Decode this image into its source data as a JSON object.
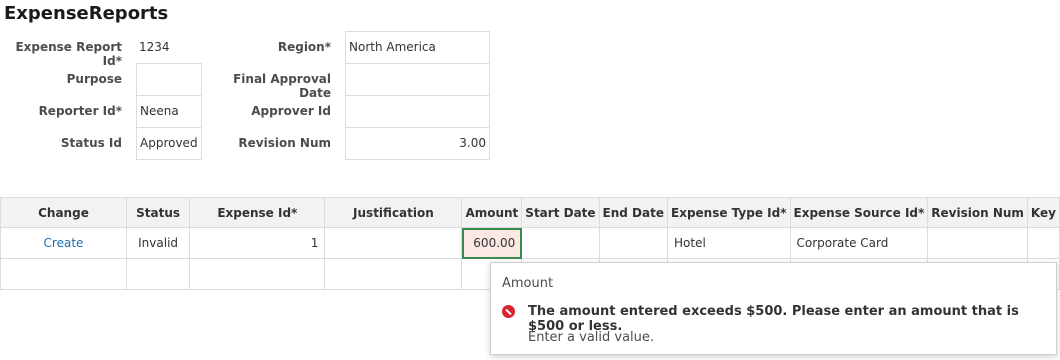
{
  "page": {
    "title": "ExpenseReports"
  },
  "form": {
    "expense_report_id": {
      "label": "Expense Report Id*",
      "value": "1234"
    },
    "purpose": {
      "label": "Purpose",
      "value": ""
    },
    "reporter_id": {
      "label": "Reporter Id*",
      "value": "Neena"
    },
    "status_id": {
      "label": "Status Id",
      "value": "Approved"
    },
    "region": {
      "label": "Region*",
      "value": "North America"
    },
    "final_approval_date": {
      "label": "Final Approval Date",
      "value": ""
    },
    "approver_id": {
      "label": "Approver Id",
      "value": ""
    },
    "revision_num": {
      "label": "Revision Num",
      "value": "3.00"
    }
  },
  "grid": {
    "columns": [
      "Change",
      "Status",
      "Expense Id*",
      "Justification",
      "Amount",
      "Start Date",
      "End Date",
      "Expense Type Id*",
      "Expense Source Id*",
      "Revision Num",
      "Key"
    ],
    "rows": [
      {
        "change": "Create",
        "status": "Invalid",
        "expense_id": "1",
        "justification": "",
        "amount": "600.00",
        "start_date": "",
        "end_date": "",
        "expense_type_id": "Hotel",
        "expense_source_id": "Corporate Card",
        "revision_num": "",
        "key": ""
      }
    ]
  },
  "error_popup": {
    "title": "Amount",
    "message": "The amount entered exceeds $500. Please enter an amount that is $500 or less.",
    "hint": "Enter a valid value.",
    "icon": "error-icon",
    "icon_color": "#d9232d"
  },
  "colors": {
    "link": "#1f6fb2",
    "error_fill": "#fbe7e4",
    "focus_border": "#3a8a4c"
  }
}
